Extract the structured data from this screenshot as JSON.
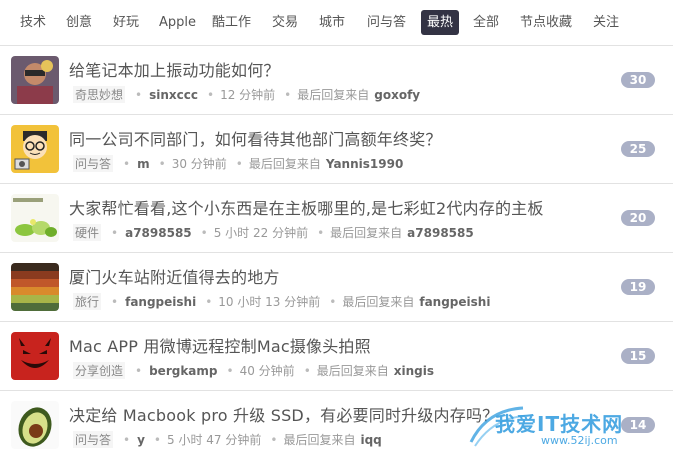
{
  "tabs": [
    {
      "label": "技术",
      "active": false
    },
    {
      "label": "创意",
      "active": false
    },
    {
      "label": "好玩",
      "active": false
    },
    {
      "label": "Apple",
      "active": false
    },
    {
      "label": "酷工作",
      "active": false
    },
    {
      "label": "交易",
      "active": false
    },
    {
      "label": "城市",
      "active": false
    },
    {
      "label": "问与答",
      "active": false
    },
    {
      "label": "最热",
      "active": true
    },
    {
      "label": "全部",
      "active": false
    },
    {
      "label": "节点收藏",
      "active": false
    },
    {
      "label": "关注",
      "active": false
    }
  ],
  "topics": [
    {
      "title": "给笔记本加上振动功能如何？",
      "node": "奇思妙想",
      "author": "sinxccc",
      "time": "12 分钟前",
      "last_label": "最后回复来自",
      "last_user": "goxofy",
      "replies": "30",
      "avatar": "photo-avatar"
    },
    {
      "title": "同一公司不同部门，如何看待其他部门高额年终奖？",
      "node": "问与答",
      "author": "m",
      "time": "30 分钟前",
      "last_label": "最后回复来自",
      "last_user": "Yannis1990",
      "replies": "25",
      "avatar": "cartoon-avatar"
    },
    {
      "title": "大家帮忙看看,这个小东西是在主板哪里的,是七彩虹2代内存的主板",
      "node": "硬件",
      "author": "a7898585",
      "time": "5 小时 22 分钟前",
      "last_label": "最后回复来自",
      "last_user": "a7898585",
      "replies": "20",
      "avatar": "leaf-avatar"
    },
    {
      "title": "厦门火车站附近值得去的地方",
      "node": "旅行",
      "author": "fangpeishi",
      "time": "10 小时 13 分钟前",
      "last_label": "最后回复来自",
      "last_user": "fangpeishi",
      "replies": "19",
      "avatar": "stripes-avatar"
    },
    {
      "title": "Mac APP 用微博远程控制Mac摄像头拍照",
      "node": "分享创造",
      "author": "bergkamp",
      "time": "40 分钟前",
      "last_label": "最后回复来自",
      "last_user": "xingis",
      "replies": "15",
      "avatar": "devil-avatar"
    },
    {
      "title": "决定给 Macbook pro 升级 SSD，有必要同时升级内存吗？",
      "node": "问与答",
      "author": "y",
      "time": "5 小时 47 分钟前",
      "last_label": "最后回复来自",
      "last_user": "iqq",
      "replies": "14",
      "avatar": "avocado-avatar"
    }
  ],
  "watermark": {
    "text": "我爱IT技术网",
    "url": "www.52ij.com"
  },
  "colors": {
    "active_tab": "#333344",
    "reply_badge": "#aab0c6"
  }
}
